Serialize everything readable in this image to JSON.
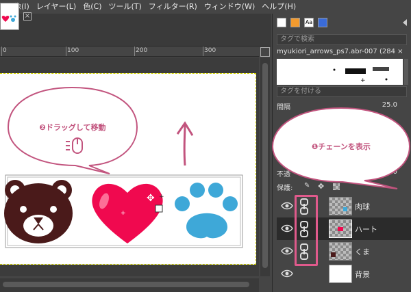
{
  "menubar": {
    "items": [
      "画像(I)",
      "レイヤー(L)",
      "色(C)",
      "ツール(T)",
      "フィルター(R)",
      "ウィンドウ(W)",
      "ヘルプ(H)"
    ]
  },
  "ruler": {
    "labels": [
      "0",
      "100",
      "200",
      "300"
    ]
  },
  "brushes_panel": {
    "tag_search_placeholder": "タグで検索",
    "brush_name": "myukiori_arrows_ps7.abr-007 (284 ×",
    "tag_assign_placeholder": "タグを付ける",
    "spacing_label": "間隔",
    "spacing_value": "25.0"
  },
  "layers_panel": {
    "opacity_label": "不透",
    "opacity_value": "100.0",
    "lock_label": "保護:",
    "layers": [
      {
        "name": "肉球",
        "active": false,
        "linked": true,
        "transparent": true
      },
      {
        "name": "ハート",
        "active": true,
        "linked": true,
        "transparent": true
      },
      {
        "name": "くま",
        "active": false,
        "linked": true,
        "transparent": true
      },
      {
        "name": "背景",
        "active": false,
        "linked": false,
        "transparent": false
      }
    ]
  },
  "annotations": {
    "drag_bubble": "❷ドラッグして移動",
    "chain_bubble": "❶チェーンを表示"
  },
  "colors": {
    "accent": "#e05a8c",
    "bubble_stroke": "#c2547e",
    "bear": "#4a1a1a",
    "heart": "#f0094f",
    "paw": "#3ea8d8"
  }
}
